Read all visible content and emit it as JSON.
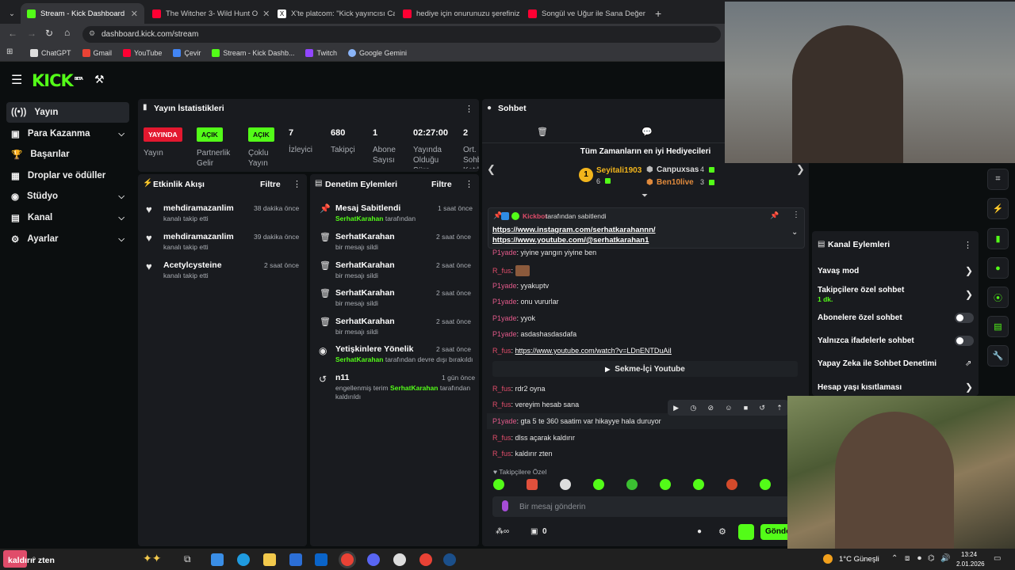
{
  "browser": {
    "tabs": [
      {
        "label": "Stream - Kick Dashboard",
        "color": "#53fc18"
      },
      {
        "label": "The Witcher 3- Wild Hunt O",
        "color": "#ff0033"
      },
      {
        "label": "X'te platcom: \"Kick yayıncısı Ca",
        "color": "#ffffff"
      },
      {
        "label": "hediye için onurunuzu şerefiniz",
        "color": "#ff0033"
      },
      {
        "label": "Songül ve Uğur ile Sana Değer",
        "color": "#ff0033"
      }
    ],
    "new_tab": "+",
    "url": "dashboard.kick.com/stream",
    "bookmarks": [
      "ChatGPT",
      "Gmail",
      "YouTube",
      "Çevir",
      "Stream - Kick Dashb...",
      "Twitch",
      "Google Gemini"
    ]
  },
  "header": {
    "logo": "KICK",
    "logo_badge": "BETA"
  },
  "sidebar": {
    "items": [
      {
        "label": "Yayın",
        "icon": "broadcast-icon"
      },
      {
        "label": "Para Kazanma",
        "icon": "money-icon"
      },
      {
        "label": "Başarılar",
        "icon": "trophy-icon"
      },
      {
        "label": "Droplar ve ödüller",
        "icon": "gift-icon"
      },
      {
        "label": "Stüdyo",
        "icon": "studio-icon"
      },
      {
        "label": "Kanal",
        "icon": "channel-icon"
      },
      {
        "label": "Ayarlar",
        "icon": "gear-icon"
      }
    ]
  },
  "stats": {
    "title": "Yayın İstatistikleri",
    "live_badge": "YAYINDA",
    "live_label": "Yayın",
    "partner_badge": "AÇIK",
    "partner_label": "Partnerlik Gelir",
    "multi_badge": "AÇIK",
    "multi_label": "Çoklu Yayın",
    "viewers": "7",
    "viewers_label": "İzleyici",
    "followers": "680",
    "followers_label": "Takipçi",
    "subs": "1",
    "subs_label": "Abone Sayısı",
    "duration": "02:27:00",
    "duration_label": "Yayında Olduğu Süre",
    "chat_count": "2",
    "chat_label": "Ort. Sohb Katıl"
  },
  "activity": {
    "title": "Etkinlik Akışı",
    "filter": "Filtre",
    "items": [
      {
        "name": "mehdiramazanlim",
        "sub": "kanalı takip etti",
        "time": "38 dakika önce"
      },
      {
        "name": "mehdiramazanlim",
        "sub": "kanalı takip etti",
        "time": "39 dakika önce"
      },
      {
        "name": "Acetylcysteine",
        "sub": "kanalı takip etti",
        "time": "2 saat önce"
      }
    ]
  },
  "moderation": {
    "title": "Denetim Eylemleri",
    "filter": "Filtre",
    "items": [
      {
        "name": "Mesaj Sabitlendi",
        "actor": "SerhatKarahan",
        "sub": "tarafından",
        "time": "1 saat önce"
      },
      {
        "name": "SerhatKarahan",
        "sub": "bir mesajı sildi",
        "time": "2 saat önce"
      },
      {
        "name": "SerhatKarahan",
        "sub": "bir mesajı sildi",
        "time": "2 saat önce"
      },
      {
        "name": "SerhatKarahan",
        "sub": "bir mesajı sildi",
        "time": "2 saat önce"
      },
      {
        "name": "SerhatKarahan",
        "sub": "bir mesajı sildi",
        "time": "2 saat önce"
      },
      {
        "name": "Yetişkinlere Yönelik",
        "actor": "SerhatKarahan",
        "sub": "tarafından devre dışı bırakıldı",
        "time": "2 saat önce"
      },
      {
        "name": "n11",
        "sub_pre": "engellenmiş terim",
        "actor": "SerhatKarahan",
        "sub": "tarafından kaldırıldı",
        "time": "1 gün önce"
      }
    ]
  },
  "chat": {
    "title": "Sohbet",
    "top_gifters_title": "Tüm Zamanların en iyi Hediyecileri",
    "gifters": [
      {
        "rank": "1",
        "name": "Seyitali1903",
        "count": "6"
      },
      {
        "name": "Canpuxsas",
        "count": "4"
      },
      {
        "name": "Ben10live",
        "count": "3"
      }
    ],
    "pinned_by_user": "Kickbot",
    "pinned_by_text": "tarafından sabitlendi",
    "pinned_links": [
      "https://www.instagram.com/serhatkarahannn/",
      "https://www.youtube.com/@serhatkarahan1"
    ],
    "messages": [
      {
        "user": "P1yade",
        "text": "yiyine yangın yiyine ben"
      },
      {
        "user": "R_fus",
        "text": ""
      },
      {
        "user": "P1yade",
        "text": "yyakuptv"
      },
      {
        "user": "P1yade",
        "text": "onu vururlar"
      },
      {
        "user": "P1yade",
        "text": "yyok"
      },
      {
        "user": "P1yade",
        "text": "asdashasdasdafa"
      },
      {
        "user": "R_fus",
        "text": "https://www.youtube.com/watch?v=LDnENTDuAiI"
      },
      {
        "user": "R_fus",
        "text": "rdr2 oyna"
      },
      {
        "user": "R_fus",
        "text": "vereyim hesab sana"
      },
      {
        "user": "P1yade",
        "text": "gta 5 te 360 saatim var hikayye hala duruyor"
      },
      {
        "user": "R_fus",
        "text": "dlss açarak kaldırır"
      },
      {
        "user": "R_fus",
        "text": "kaldırır zten"
      }
    ],
    "embed_label": "Sekme-İçi Youtube",
    "followers_only": "Takipçilere Özel",
    "input_placeholder": "Bir mesaj gönderin",
    "footer_count": "0",
    "send_label": "Gönde"
  },
  "channel_actions": {
    "title": "Kanal Eylemleri",
    "items": [
      {
        "label": "Yavaş mod",
        "control": "chevron"
      },
      {
        "label": "Takipçilere özel sohbet",
        "sub": "1 dk.",
        "control": "chevron"
      },
      {
        "label": "Abonelere özel sohbet",
        "control": "toggle"
      },
      {
        "label": "Yalnızca ifadelerle sohbet",
        "control": "toggle"
      },
      {
        "label": "Yapay Zeka ile Sohbet Denetimi",
        "control": "external"
      },
      {
        "label": "Hesap yaşı kısıtlaması",
        "control": "chevron"
      }
    ]
  },
  "taskbar": {
    "search_text": "kaldırır zten",
    "weather": "1°C  Güneşli",
    "time": "13:24",
    "date": "2.01.2026"
  }
}
